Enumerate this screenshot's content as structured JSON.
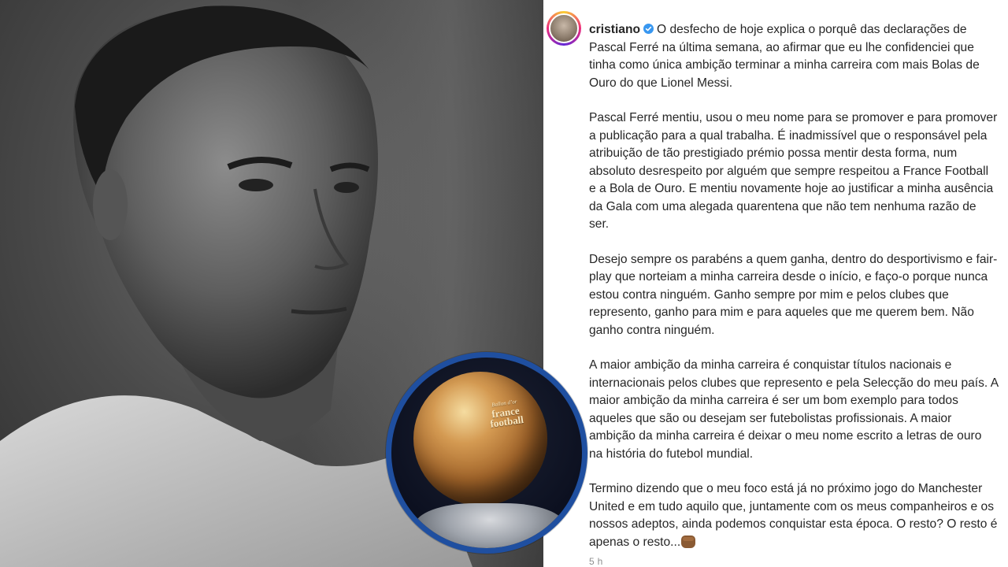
{
  "post": {
    "username": "cristiano",
    "verified": true,
    "paragraphs": [
      "O desfecho de hoje explica o porquê das declarações de Pascal Ferré na última semana, ao afirmar que eu lhe confidenciei que tinha como única ambição terminar a minha carreira com mais Bolas de Ouro do que Lionel Messi.",
      "Pascal Ferré mentiu, usou o meu nome para se promover e para promover a publicação para a qual trabalha. É inadmissível que o responsável pela atribuição de tão prestigiado prémio possa mentir desta forma, num absoluto desrespeito por alguém que sempre respeitou a France Football e a Bola de Ouro. E mentiu novamente hoje ao justificar a minha ausência da Gala com uma alegada quarentena que não tem nenhuma razão de ser.",
      "Desejo sempre os parabéns a quem ganha, dentro do desportivismo e fair-play que norteiam a minha carreira desde o início, e faço-o porque nunca estou contra ninguém. Ganho sempre por mim e pelos clubes que represento, ganho para mim e para aqueles que me querem bem. Não ganho contra ninguém.",
      "A maior ambição da minha carreira é conquistar títulos nacionais e internacionais pelos clubes que represento e pela Selecção do meu país. A maior ambição da minha carreira é ser um bom exemplo para todos aqueles que são ou desejam ser futebolistas profissionais. A maior ambição da minha carreira é deixar o meu nome escrito a letras de ouro na história do futebol mundial.",
      "Termino dizendo que o meu foco está já no próximo jogo do Manchester United e em tudo aquilo que, juntamente com os meus companheiros e os nossos adeptos, ainda podemos conquistar esta época. O resto? O resto é apenas o resto..."
    ],
    "end_emoji": "fist-emoji-icon",
    "timestamp": "5 h"
  },
  "ball_inset": {
    "engraving_small": "Ballon dʼor",
    "engraving_line1": "france",
    "engraving_line2": "football"
  },
  "colors": {
    "verified_blue": "#3897f0",
    "inset_border": "#1f4fa0",
    "text": "#262626",
    "muted": "#8e8e8e"
  }
}
